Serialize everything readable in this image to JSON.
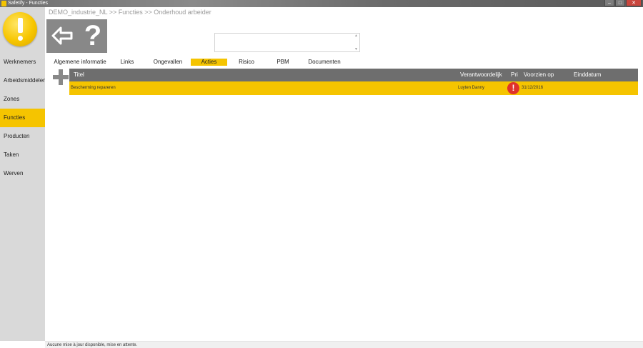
{
  "window": {
    "title": "Safetify - Functies",
    "controls": {
      "minimize": "–",
      "maximize": "□",
      "close": "✕"
    }
  },
  "sidebar": {
    "logo_icon": "warning-exclamation-icon",
    "items": [
      {
        "label": "Werknemers",
        "active": false
      },
      {
        "label": "Arbeidsmiddelen",
        "active": false
      },
      {
        "label": "Zones",
        "active": false
      },
      {
        "label": "Functies",
        "active": true
      },
      {
        "label": "Producten",
        "active": false
      },
      {
        "label": "Taken",
        "active": false
      },
      {
        "label": "Werven",
        "active": false
      }
    ]
  },
  "header": {
    "breadcrumb": "DEMO_industrie_NL >> Functies >> Onderhoud arbeider",
    "back_icon": "arrow-left-icon",
    "help_label": "?"
  },
  "textbox": {
    "value": ""
  },
  "tabs": [
    {
      "label": "Algemene informatie",
      "active": false
    },
    {
      "label": "Links",
      "active": false
    },
    {
      "label": "Ongevallen",
      "active": false
    },
    {
      "label": "Acties",
      "active": true
    },
    {
      "label": "Risico",
      "active": false
    },
    {
      "label": "PBM",
      "active": false
    },
    {
      "label": "Documenten",
      "active": false
    }
  ],
  "table": {
    "columns": {
      "titel": "Titel",
      "verantwoordelijk": "Verantwoordelijk",
      "pri": "Pri",
      "voorzien_op": "Voorzien op",
      "einddatum": "Einddatum"
    },
    "rows": [
      {
        "titel": "Bescherming repareren",
        "verantwoordelijk": "Luyten Danny",
        "pri_icon": "exclamation-circle-icon",
        "pri_glyph": "!",
        "voorzien_op": "31/12/2016",
        "einddatum": ""
      }
    ]
  },
  "status": {
    "text": "Aucune mise à jour disponible, mise en attente."
  },
  "colors": {
    "accent": "#f5c400",
    "header": "#6e6e6e",
    "sidebar": "#d9d9d9",
    "priority_high": "#e0322b"
  }
}
